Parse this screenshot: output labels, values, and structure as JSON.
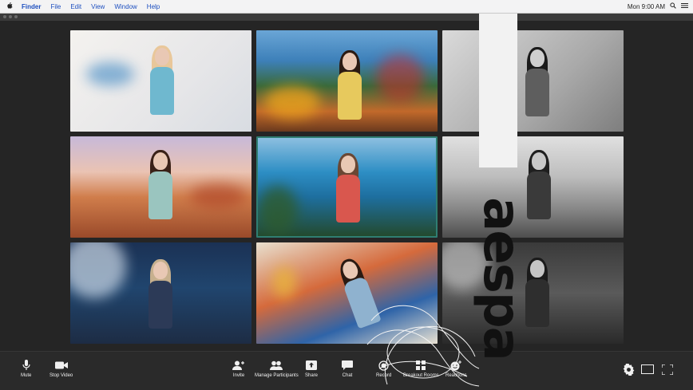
{
  "menubar": {
    "items": [
      "Finder",
      "File",
      "Edit",
      "View",
      "Window",
      "Help"
    ],
    "clock": "Mon 9:00 AM"
  },
  "toolbar": {
    "mute": "Mute",
    "stop_video": "Stop Video",
    "invite": "Invite",
    "manage_participants": "Manage Participants",
    "share": "Share",
    "chat": "Chat",
    "record": "Record",
    "breakout_rooms": "Breakout Rooms",
    "reactions": "Reactions"
  },
  "overlay": {
    "text": "aespa"
  },
  "icons": [
    "apple-icon",
    "search-icon",
    "list-icon",
    "microphone-icon",
    "video-camera-icon",
    "invite-icon",
    "participants-icon",
    "share-icon",
    "chat-icon",
    "record-icon",
    "breakout-rooms-icon",
    "reactions-icon",
    "settings-gear-icon",
    "gallery-view-icon",
    "fullscreen-icon"
  ],
  "colors": {
    "menu_text": "#1d4fbf",
    "toolbar_bg": "#2a2a2a",
    "stage_bg": "#252525",
    "active_speaker_border": "#2f7e72"
  }
}
